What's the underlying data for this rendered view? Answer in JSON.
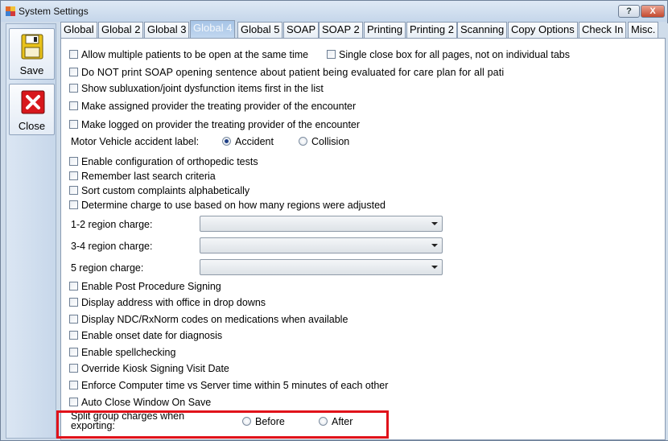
{
  "window": {
    "title": "System Settings",
    "help_glyph": "?",
    "close_glyph": "X"
  },
  "toolbar": {
    "save_label": "Save",
    "close_label": "Close"
  },
  "tabs": [
    {
      "label": "Global"
    },
    {
      "label": "Global 2"
    },
    {
      "label": "Global 3"
    },
    {
      "label": "Global 4"
    },
    {
      "label": "Global 5"
    },
    {
      "label": "SOAP"
    },
    {
      "label": "SOAP 2"
    },
    {
      "label": "Printing"
    },
    {
      "label": "Printing 2"
    },
    {
      "label": "Scanning"
    },
    {
      "label": "Copy Options"
    },
    {
      "label": "Check In"
    },
    {
      "label": "Misc."
    }
  ],
  "active_tab": "Global 4",
  "options": {
    "allow_multiple_patients": "Allow multiple patients to be open at the same time",
    "single_close_box": "Single close box for all pages, not on individual tabs",
    "no_soap_opening": "Do NOT print SOAP opening sentence about patient being evaluated for care plan for all pati",
    "show_subluxation": "Show subluxation/joint dysfunction items first in the list",
    "assigned_provider": "Make assigned provider the treating provider of the encounter",
    "logged_provider": "Make logged on provider the treating provider of the encounter",
    "mv_label": "Motor Vehicle accident label:",
    "mv_accident": "Accident",
    "mv_collision": "Collision",
    "ortho_tests": "Enable configuration of orthopedic tests",
    "remember_search": "Remember last search criteria",
    "sort_complaints": "Sort custom complaints alphabetically",
    "determine_charge": "Determine charge to use based on how many regions were adjusted",
    "region_12": "1-2 region charge:",
    "region_34": "3-4 region charge:",
    "region_5": "5 region charge:",
    "post_procedure": "Enable Post Procedure Signing",
    "display_address": "Display address with office in drop downs",
    "ndc_codes": "Display NDC/RxNorm codes on medications when available",
    "onset_date": "Enable onset date for diagnosis",
    "spellcheck": "Enable spellchecking",
    "kiosk_date": "Override Kiosk Signing Visit Date",
    "enforce_time": "Enforce Computer time vs Server time within 5 minutes of each other",
    "auto_close": "Auto Close Window On Save",
    "split_line1": "Split group charges when",
    "split_line2": "exporting:",
    "split_before": "Before",
    "split_after": "After"
  },
  "colors": {
    "highlight_box": "#e0121a",
    "active_tab": "#a6c4e6"
  }
}
